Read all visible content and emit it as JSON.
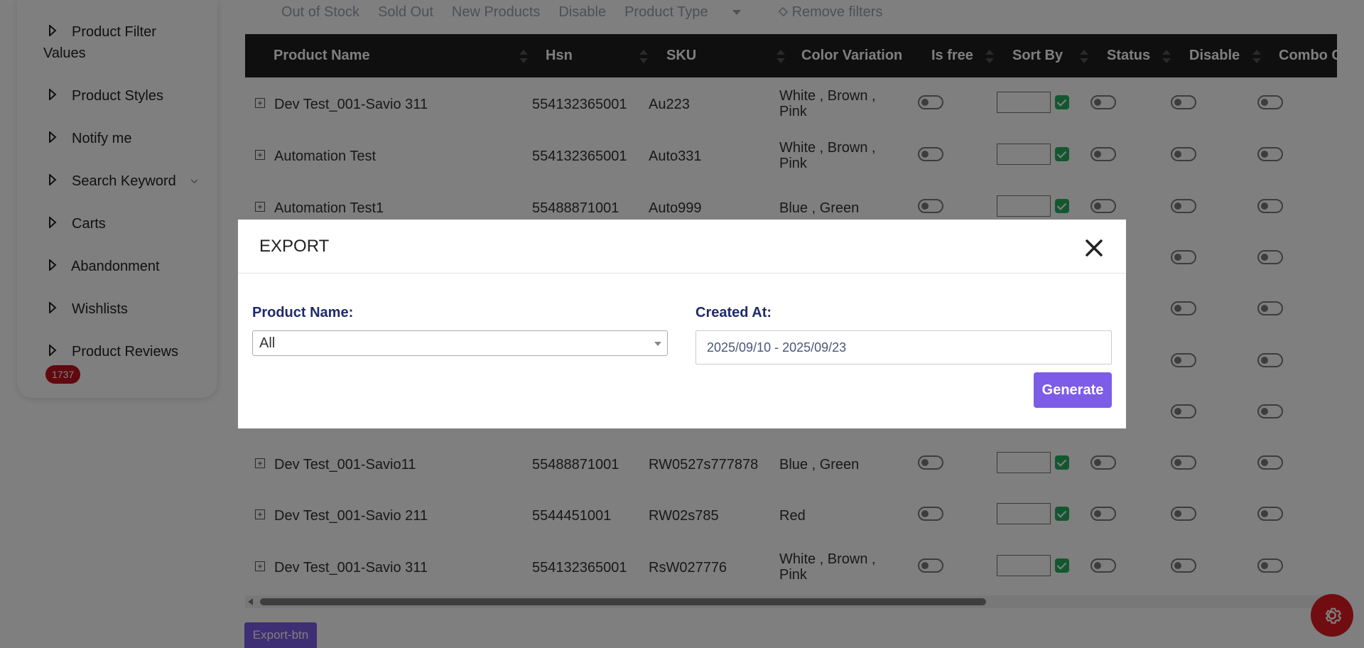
{
  "sidebar": {
    "items": [
      {
        "label": "Product Filter",
        "label2": "Values"
      },
      {
        "label": "Product Styles"
      },
      {
        "label": "Notify me"
      },
      {
        "label": "Search Keyword"
      },
      {
        "label": "Carts"
      },
      {
        "label": "Abandonment"
      },
      {
        "label": "Wishlists"
      },
      {
        "label": "Product Reviews"
      }
    ],
    "badge": "1737"
  },
  "filters": {
    "out_of_stock": "Out of Stock",
    "sold_out": "Sold Out",
    "new_products": "New Products",
    "disable": "Disable",
    "product_type": "Product Type",
    "remove_filters": "Remove filters"
  },
  "table": {
    "headers": [
      "Product Name",
      "Hsn",
      "SKU",
      "Color Variation",
      "Is free",
      "Sort By",
      "Status",
      "Disable",
      "Combo C"
    ],
    "rows": [
      {
        "name": "Dev Test_001-Savio 311",
        "hsn": "554132365001",
        "sku": "Au223",
        "color1": "White , Brown ,",
        "color2": "Pink"
      },
      {
        "name": "Automation Test",
        "hsn": "554132365001",
        "sku": "Auto331",
        "color1": "White , Brown ,",
        "color2": "Pink"
      },
      {
        "name": "Automation Test1",
        "hsn": "55488871001",
        "sku": "Auto999",
        "color1": "Blue , Green",
        "color2": ""
      },
      {
        "name": "Dev Test_001-Savio11",
        "hsn": "55488871001",
        "sku": "RW0527s777878",
        "color1": "Blue , Green",
        "color2": ""
      },
      {
        "name": "Dev Test_001-Savio 211",
        "hsn": "5544451001",
        "sku": "RW02s785",
        "color1": "Red",
        "color2": ""
      },
      {
        "name": "Dev Test_001-Savio 311",
        "hsn": "554132365001",
        "sku": "RsW027776",
        "color1": "White , Brown ,",
        "color2": "Pink"
      }
    ]
  },
  "export_button": "Export-btn",
  "modal": {
    "title": "EXPORT",
    "product_name_label": "Product Name:",
    "product_name_value": "All",
    "created_at_label": "Created At:",
    "created_at_value": "2025/09/10 - 2025/09/23",
    "generate_label": "Generate"
  },
  "colors": {
    "accent": "#7d5ce8",
    "header_bg": "#1f1f1f",
    "badge": "#c1121f",
    "gear_button": "#e21b23",
    "label_navy": "#1e2a6a"
  }
}
